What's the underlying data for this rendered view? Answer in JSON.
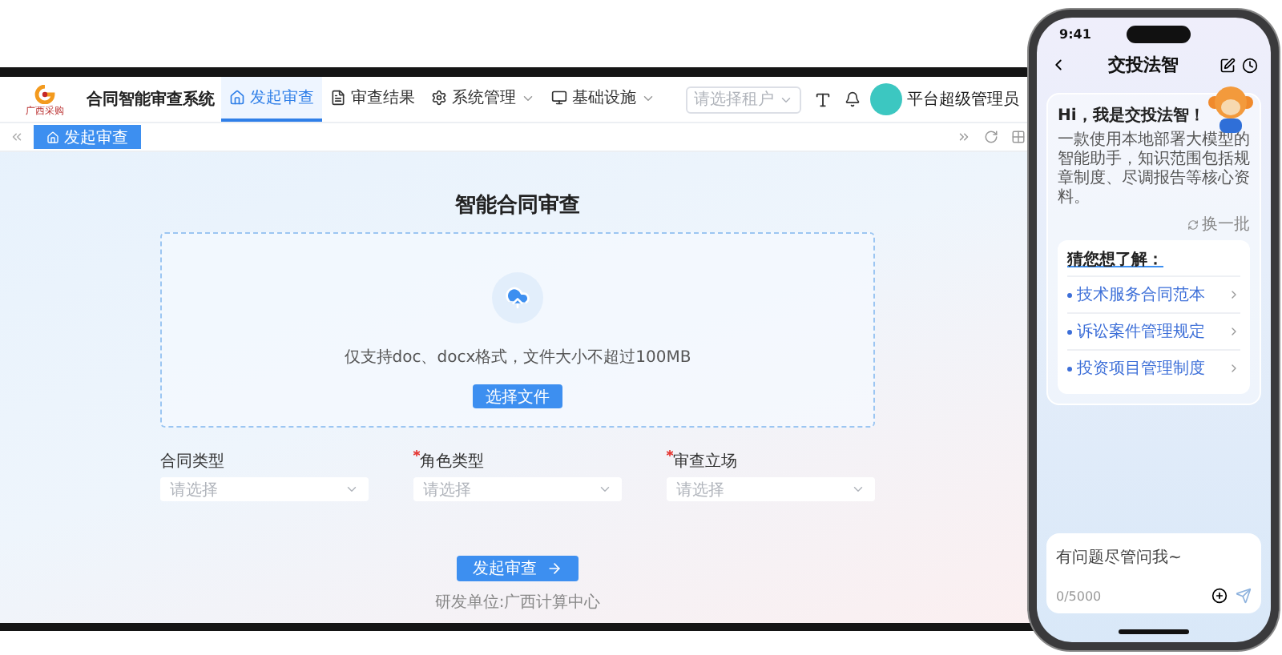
{
  "laptop": {
    "app": {
      "logo_caption": "广西采购",
      "title": "合同智能审查系统"
    },
    "nav_tabs": [
      {
        "label": "发起审查",
        "selected": true,
        "kind": "home",
        "has_menu": false
      },
      {
        "label": "审查结果",
        "selected": false,
        "kind": "document",
        "has_menu": false
      },
      {
        "label": "系统管理",
        "selected": false,
        "kind": "settings",
        "has_menu": true
      },
      {
        "label": "基础设施",
        "selected": false,
        "kind": "monitor",
        "has_menu": true
      }
    ],
    "tenant_select": {
      "placeholder": "请选择租户"
    },
    "user": {
      "name": "平台超级管理员"
    },
    "tag_tabs": [
      {
        "label": "发起审查",
        "selected": true
      }
    ],
    "page": {
      "title": "智能合同审查",
      "upload_hint": "仅支持doc、docx格式，文件大小不超过100MB",
      "upload_button": "选择文件",
      "fields": [
        {
          "label": "合同类型",
          "required": false,
          "placeholder": "请选择"
        },
        {
          "label": "角色类型",
          "required": true,
          "placeholder": "请选择"
        },
        {
          "label": "审查立场",
          "required": true,
          "placeholder": "请选择"
        }
      ],
      "submit_button": "发起审查",
      "footer": "研发单位:广西计算中心"
    }
  },
  "phone": {
    "time": "9:41",
    "title": "交投法智",
    "greeting": "Hi，我是交投法智！",
    "intro": "一款使用本地部署大模型的智能助手，知识范围包括规章制度、尽调报告等核心资料。",
    "refresh": "换一批",
    "suggest_title": "猜您想了解：",
    "suggestions": [
      "技术服务合同范本",
      "诉讼案件管理规定",
      "投资项目管理制度"
    ],
    "input": {
      "placeholder": "有问题尽管问我~",
      "counter": "0/5000"
    }
  }
}
